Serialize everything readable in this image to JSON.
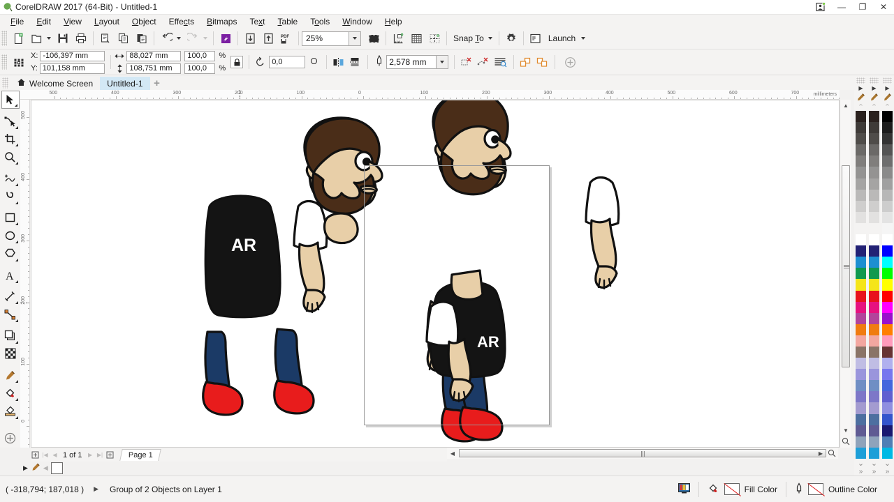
{
  "window": {
    "title": "CorelDRAW 2017 (64-Bit) - Untitled-1",
    "logo_icon": "corel-balloon-icon",
    "controls": {
      "account_icon": "user-account-icon",
      "minimize": "—",
      "restore": "❐",
      "close": "✕"
    }
  },
  "menubar": {
    "items": [
      {
        "label": "File",
        "mnemonic": "F"
      },
      {
        "label": "Edit",
        "mnemonic": "E"
      },
      {
        "label": "View",
        "mnemonic": "V"
      },
      {
        "label": "Layout",
        "mnemonic": "L"
      },
      {
        "label": "Object",
        "mnemonic": "O"
      },
      {
        "label": "Effects",
        "mnemonic": "c"
      },
      {
        "label": "Bitmaps",
        "mnemonic": "B"
      },
      {
        "label": "Text",
        "mnemonic": "x"
      },
      {
        "label": "Table",
        "mnemonic": "T"
      },
      {
        "label": "Tools",
        "mnemonic": "o"
      },
      {
        "label": "Window",
        "mnemonic": "W"
      },
      {
        "label": "Help",
        "mnemonic": "H"
      }
    ]
  },
  "toolbar": {
    "new_icon": "new-document-icon",
    "open_icon": "open-folder-icon",
    "save_icon": "save-disk-icon",
    "print_icon": "print-icon",
    "cut_icon": "cut-icon",
    "copy_icon": "copy-icon",
    "paste_icon": "paste-icon",
    "undo_icon": "undo-arrow-icon",
    "redo_icon": "redo-arrow-icon",
    "search_content_icon": "search-content-icon",
    "import_icon": "import-down-arrow-icon",
    "export_icon": "export-up-arrow-icon",
    "publish_pdf_icon": "publish-to-pdf-icon",
    "zoom_level": "25%",
    "zoom_dropdown_icon": "chevron-down-icon",
    "fullscreen_icon": "full-screen-preview-icon",
    "show_rulers_icon": "show-rulers-icon",
    "show_grid_icon": "show-grid-icon",
    "show_guides_icon": "show-guidelines-icon",
    "snap_to_label": "Snap To",
    "snap_to_mnemonic": "T",
    "options_icon": "gear-options-icon",
    "launch_icon": "application-launcher-icon",
    "launch_label": "Launch"
  },
  "propertybar": {
    "object_position_icon": "object-position-icon",
    "x_label": "X:",
    "x_value": "-106,397 mm",
    "y_label": "Y:",
    "y_value": "101,158 mm",
    "width_icon": "object-width-icon",
    "width_value": "88,027 mm",
    "height_icon": "object-height-icon",
    "height_value": "108,751 mm",
    "scale_x": "100,0",
    "scale_y": "100,0",
    "percent_symbol": "%",
    "lock_ratio_icon": "lock-ratio-icon",
    "rotate_icon": "angle-of-rotation-icon",
    "rotation_value": "0,0",
    "degree_icon": "degree-circle-icon",
    "mirror_horizontal_icon": "mirror-horizontally-icon",
    "mirror_vertical_icon": "mirror-vertically-icon",
    "outline_pen_icon": "outline-width-pen-icon",
    "outline_width": "2,578 mm",
    "outline_dropdown_icon": "chevron-down-icon",
    "convert_outline_icon": "convert-outline-to-object-icon",
    "simplify_icon": "simplify-icon",
    "text_wrap_icon": "wrap-paragraph-text-icon",
    "to_front_icon": "to-front-of-layer-icon",
    "to_back_icon": "to-back-of-layer-icon",
    "add_icon": "add-more-tools-icon"
  },
  "doctabs": {
    "home_icon": "home-icon",
    "tabs": [
      {
        "label": "Welcome Screen",
        "active": false
      },
      {
        "label": "Untitled-1",
        "active": true
      }
    ],
    "add_tab_icon": "plus-icon"
  },
  "toolbox": {
    "tools": [
      {
        "name": "pick-tool",
        "icon": "arrow-cursor-icon",
        "selected": true
      },
      {
        "name": "shape-tool",
        "icon": "node-edit-shape-icon",
        "selected": false
      },
      {
        "name": "crop-tool",
        "icon": "crop-icon",
        "selected": false
      },
      {
        "name": "zoom-tool",
        "icon": "magnifier-icon",
        "selected": false
      },
      {
        "name": "freehand-tool",
        "icon": "freehand-pencil-icon",
        "selected": false
      },
      {
        "name": "artistic-media-tool",
        "icon": "artistic-media-brush-icon",
        "selected": false
      },
      {
        "name": "rectangle-tool",
        "icon": "rectangle-icon",
        "selected": false
      },
      {
        "name": "ellipse-tool",
        "icon": "ellipse-icon",
        "selected": false
      },
      {
        "name": "polygon-tool",
        "icon": "polygon-icon",
        "selected": false
      },
      {
        "name": "text-tool",
        "icon": "letter-a-icon",
        "selected": false
      },
      {
        "name": "parallel-dimension-tool",
        "icon": "dimension-line-icon",
        "selected": false
      },
      {
        "name": "straight-line-connector-tool",
        "icon": "connector-line-icon",
        "selected": false
      },
      {
        "name": "drop-shadow-tool",
        "icon": "drop-shadow-icon",
        "selected": false
      },
      {
        "name": "transparency-tool",
        "icon": "checkerboard-transparency-icon",
        "selected": false
      },
      {
        "name": "color-eyedropper-tool",
        "icon": "eyedropper-icon",
        "selected": false
      },
      {
        "name": "interactive-fill-tool",
        "icon": "paint-bucket-fill-icon",
        "selected": false
      },
      {
        "name": "smart-fill-tool",
        "icon": "smart-fill-icon",
        "selected": false
      },
      {
        "name": "quick-customize-tool",
        "icon": "plus-circle-icon",
        "selected": false
      }
    ]
  },
  "rulers": {
    "unit_label": "millimeters",
    "horizontal_ticks": [
      "500",
      "400",
      "300",
      "200",
      "100",
      "0",
      "100",
      "200",
      "300",
      "400",
      "500",
      "600",
      "700"
    ],
    "vertical_ticks": [
      "500",
      "400",
      "300",
      "200",
      "100",
      "0"
    ]
  },
  "pagenav": {
    "first_page_icon": "first-page-icon",
    "prev_page_icon": "previous-page-icon",
    "page_counter": "1 of 1",
    "next_page_icon": "next-page-icon",
    "last_page_icon": "last-page-icon",
    "add_page_start_icon": "add-page-before-icon",
    "add_page_end_icon": "add-page-after-icon",
    "page_tab_label": "Page 1"
  },
  "minibar": {
    "expand_icon": "expand-arrow-icon",
    "eyedropper_icon": "eyedropper-icon",
    "back_icon": "previous-swatch-icon",
    "swatch_color": "#ffffff"
  },
  "statusbar": {
    "cursor_position": "( -318,794; 187,018 )",
    "expand_icon": "expand-arrow-icon",
    "object_info": "Group of 2 Objects on Layer 1",
    "color_proof_icon": "color-proof-settings-icon",
    "fill_icon": "fill-bucket-icon",
    "fill_label": "Fill Color",
    "fill_value": "none",
    "outline_icon": "outline-pen-icon",
    "outline_label": "Outline Color",
    "outline_value": "none"
  },
  "palette": {
    "scroll_up_icon": "chevron-up-icon",
    "scroll_down_icon": "chevron-down-icon",
    "expand_icon": "expand-palette-icon",
    "eyedropper_icon": "eyedropper-icon",
    "arrow_icon": "palette-menu-arrow-icon",
    "columns": [
      {
        "name": "palette-column-1",
        "colors": [
          "#2a211e",
          "#3e3a37",
          "#4f4c49",
          "#6b6967",
          "#807e7c",
          "#949392",
          "#a5a4a3",
          "#bab9b8",
          "#cfcecd",
          "#e2e1e0",
          "#f4f3f2",
          "#ffffff",
          "#232275",
          "#1d8fd1",
          "#10994e",
          "#f5e51a",
          "#e8111c",
          "#e6117f",
          "#b2439b",
          "#f07c10",
          "#f3a7a0",
          "#8a7467",
          "#c0bde4",
          "#9a95dc",
          "#6f8ec4",
          "#7d77c8",
          "#a39bd0",
          "#4d6fa0",
          "#5f5b93",
          "#8fa3bb",
          "#1e9fd8"
        ]
      },
      {
        "name": "palette-column-2",
        "colors": [
          "#000000",
          "#1c1c1c",
          "#333333",
          "#545454",
          "#6e6e6e",
          "#8a8a8a",
          "#a0a0a0",
          "#b7b7b7",
          "#cdcdcd",
          "#e3e3e3",
          "#f5f5f5",
          "#ffffff",
          "#0000ff",
          "#00ffff",
          "#00ff00",
          "#ffff00",
          "#ff0000",
          "#ff00ff",
          "#9911cc",
          "#ff7f00",
          "#ff9bbb",
          "#663333",
          "#b0b0ee",
          "#7777ee",
          "#4466dd",
          "#5f5fd0",
          "#8f8fe0",
          "#3355cc",
          "#191970",
          "#4f7fb5",
          "#00b9e4"
        ]
      }
    ]
  },
  "artwork": {
    "description": "Cartoon bearded man illustration: assembled figure on page plus exploded body parts on the pasteboard",
    "shirt_text": "AR",
    "colors": {
      "skin": "#e8cfa8",
      "hair": "#4a2d18",
      "beard": "#4a2d18",
      "shirt": "#141414",
      "sleeve": "#ffffff",
      "pants": "#1b3a66",
      "shoes": "#e81c1c",
      "outline": "#000000"
    }
  }
}
